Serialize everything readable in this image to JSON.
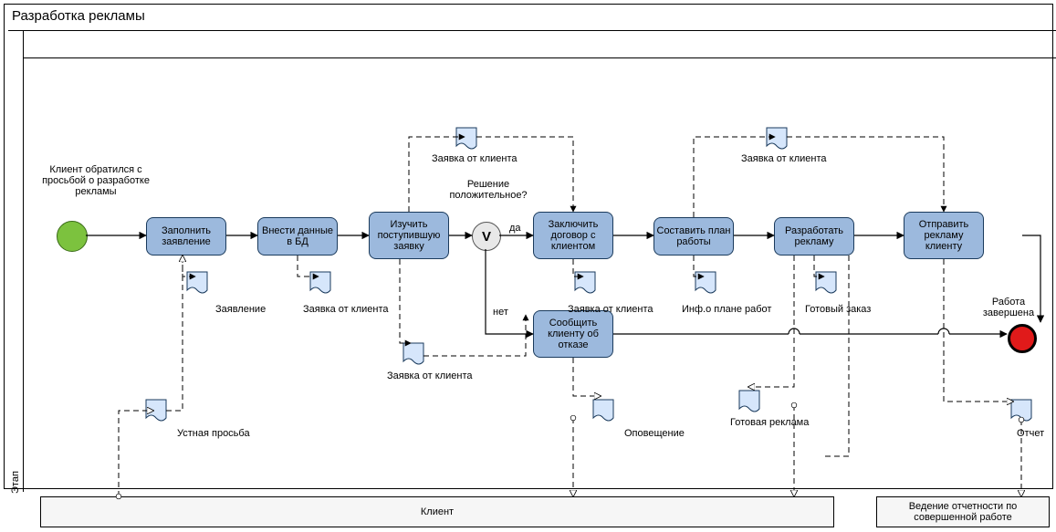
{
  "pool_title": "Разработка рекламы",
  "lane_label": "Этап",
  "start_label": "Клиент обратился с просьбой о разработке рекламы",
  "end_label": "Работа завершена",
  "gateway_label": "Решение положительное?",
  "gateway_mark": "V",
  "flow_yes": "да",
  "flow_no": "нет",
  "tasks": {
    "t1": "Заполнить заявление",
    "t2": "Внести данные в БД",
    "t3": "Изучить поступившую заявку",
    "t4": "Заключить договор с клиентом",
    "t5": "Составить план работы",
    "t6": "Разработать рекламу",
    "t7": "Отправить рекламу клиенту",
    "t8": "Сообщить клиенту об отказе"
  },
  "docs": {
    "d1": "Заявление",
    "d2": "Заявка от клиента",
    "d3": "Заявка от клиента",
    "d4": "Заявка от клиента",
    "d5": "Заявка от клиента",
    "d6": "Инф.о плане работ",
    "d7": "Готовый заказ",
    "d8": "Заявка от клиента",
    "d9": "Устная просьба",
    "d10": "Оповещение",
    "d11": "Готовая реклама",
    "d12": "Отчет"
  },
  "ext": {
    "client": "Клиент",
    "reporting": "Ведение отчетности по совершенной работе"
  }
}
